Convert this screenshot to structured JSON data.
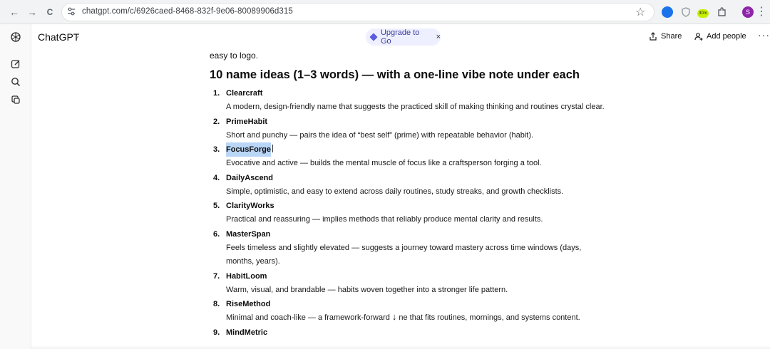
{
  "browser": {
    "url": "chatgpt.com/c/6926caed-8468-832f-9e06-80089906d315",
    "back_glyph": "←",
    "forward_glyph": "→",
    "reload_glyph": "C",
    "star_glyph": "☆",
    "kebab_glyph": "⋮",
    "extensions": [
      {
        "name": "shield-ext-icon",
        "color": "#1a73e8"
      },
      {
        "name": "shield-outline-ext-icon",
        "color": "#9aa0a6"
      },
      {
        "name": "timer-ext-icon",
        "color": "#c6f000",
        "label": "30m"
      },
      {
        "name": "puzzle-ext-icon",
        "color": "#5f6368"
      },
      {
        "name": "profile-avatar-icon",
        "color": "#8e24aa",
        "label": "S"
      }
    ]
  },
  "header": {
    "app_title": "ChatGPT",
    "chevron": "⌄",
    "upgrade_label": "Upgrade to Go",
    "upgrade_close": "×",
    "share_label": "Share",
    "add_people_label": "Add people",
    "more_glyph": "···"
  },
  "content": {
    "intro_tail": "easy to logo.",
    "heading": "10 name ideas (1–3 words) — with a one-line vibe note under each",
    "ideas": [
      {
        "num": "1.",
        "name": "Clearcraft",
        "note": "A modern, design-friendly name that suggests the practiced skill of making thinking and routines crystal clear."
      },
      {
        "num": "2.",
        "name": "PrimeHabit",
        "note": "Short and punchy — pairs the idea of “best self” (prime) with repeatable behavior (habit)."
      },
      {
        "num": "3.",
        "name": "FocusForge",
        "note": "Evocative and active — builds the mental muscle of focus like a craftsperson forging a tool."
      },
      {
        "num": "4.",
        "name": "DailyAscend",
        "note": "Simple, optimistic, and easy to extend across daily routines, study streaks, and growth checklists."
      },
      {
        "num": "5.",
        "name": "ClarityWorks",
        "note": "Practical and reassuring — implies methods that reliably produce mental clarity and results."
      },
      {
        "num": "6.",
        "name": "MasterSpan",
        "note": "Feels timeless and slightly elevated — suggests a journey toward mastery across time windows (days, months, years)."
      },
      {
        "num": "7.",
        "name": "HabitLoom",
        "note": "Warm, visual, and brandable — habits woven together into a stronger life pattern."
      },
      {
        "num": "8.",
        "name": "RiseMethod",
        "note_before": "Minimal and coach-like — a framework-forward",
        "note_arrow": "↓",
        "note_after": "ne that fits routines, mornings, and systems content."
      },
      {
        "num": "9.",
        "name": "MindMetric"
      }
    ]
  }
}
